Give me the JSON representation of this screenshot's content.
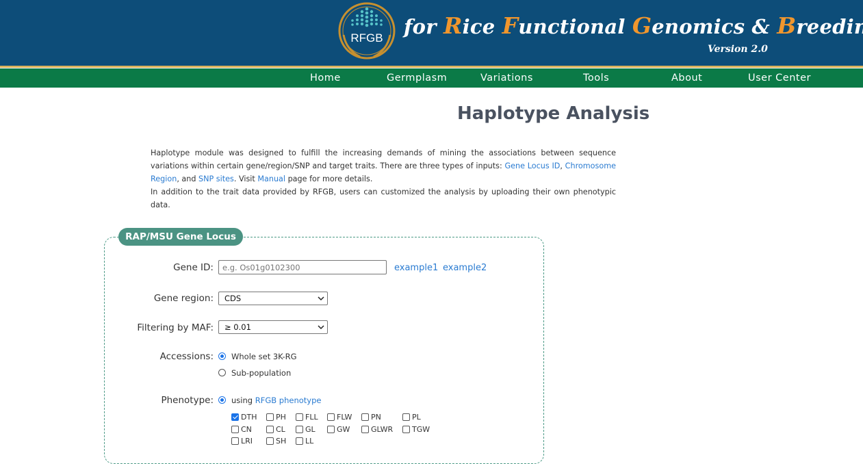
{
  "header": {
    "logo_text": "RFGB",
    "title_parts": [
      {
        "text": "for ",
        "cap": false
      },
      {
        "text": "R",
        "cap": true
      },
      {
        "text": "ice ",
        "cap": false
      },
      {
        "text": "F",
        "cap": true
      },
      {
        "text": "unctional ",
        "cap": false
      },
      {
        "text": "G",
        "cap": true
      },
      {
        "text": "enomics & ",
        "cap": false
      },
      {
        "text": "B",
        "cap": true
      },
      {
        "text": "reeding",
        "cap": false
      }
    ],
    "version": "Version 2.0",
    "colors": {
      "banner": "#0d4d79",
      "accent": "#f0962d",
      "nav": "#0b7a47",
      "gold": "#d9b25c"
    }
  },
  "nav": {
    "home": "Home",
    "germplasm": "Germplasm",
    "variations": "Variations",
    "tools": "Tools",
    "about": "About",
    "user_center": "User Center"
  },
  "page": {
    "title": "Haplotype Analysis",
    "intro": {
      "p1_a": "Haplotype module was designed to fulfill the increasing demands of mining the associations between sequence variations within certain gene/region/SNP and target traits. There are three types of inputs: ",
      "link_gene_locus": "Gene Locus ID",
      "p1_b": ", ",
      "link_chrom_region": "Chromosome Region",
      "p1_c": ", and ",
      "link_snp_sites": "SNP sites",
      "p1_d": ". Visit ",
      "link_manual": "Manual",
      "p1_e": " page for more details.",
      "p2": "In addition to the trait data provided by RFGB, users can customized the analysis by uploading their own phenotypic data."
    }
  },
  "form": {
    "legend": "RAP/MSU Gene Locus",
    "gene_id": {
      "label": "Gene ID:",
      "placeholder": "e.g. Os01g0102300",
      "value": "",
      "example1": "example1",
      "example2": "example2"
    },
    "gene_region": {
      "label": "Gene region:",
      "selected": "CDS"
    },
    "maf": {
      "label": "Filtering by MAF:",
      "selected": "≥ 0.01"
    },
    "accessions": {
      "label": "Accessions:",
      "options": [
        {
          "label": "Whole set 3K-RG",
          "checked": true
        },
        {
          "label": "Sub-population",
          "checked": false
        }
      ]
    },
    "phenotype": {
      "label": "Phenotype:",
      "using_prefix": "using ",
      "using_link": "RFGB phenotype",
      "traits": [
        {
          "label": "DTH",
          "checked": true
        },
        {
          "label": "PH",
          "checked": false
        },
        {
          "label": "FLL",
          "checked": false
        },
        {
          "label": "FLW",
          "checked": false
        },
        {
          "label": "PN",
          "checked": false
        },
        {
          "label": "PL",
          "checked": false
        },
        {
          "label": "CN",
          "checked": false
        },
        {
          "label": "CL",
          "checked": false
        },
        {
          "label": "GL",
          "checked": false
        },
        {
          "label": "GW",
          "checked": false
        },
        {
          "label": "GLWR",
          "checked": false
        },
        {
          "label": "TGW",
          "checked": false
        },
        {
          "label": "LRI",
          "checked": false
        },
        {
          "label": "SH",
          "checked": false
        },
        {
          "label": "LL",
          "checked": false
        }
      ]
    }
  }
}
